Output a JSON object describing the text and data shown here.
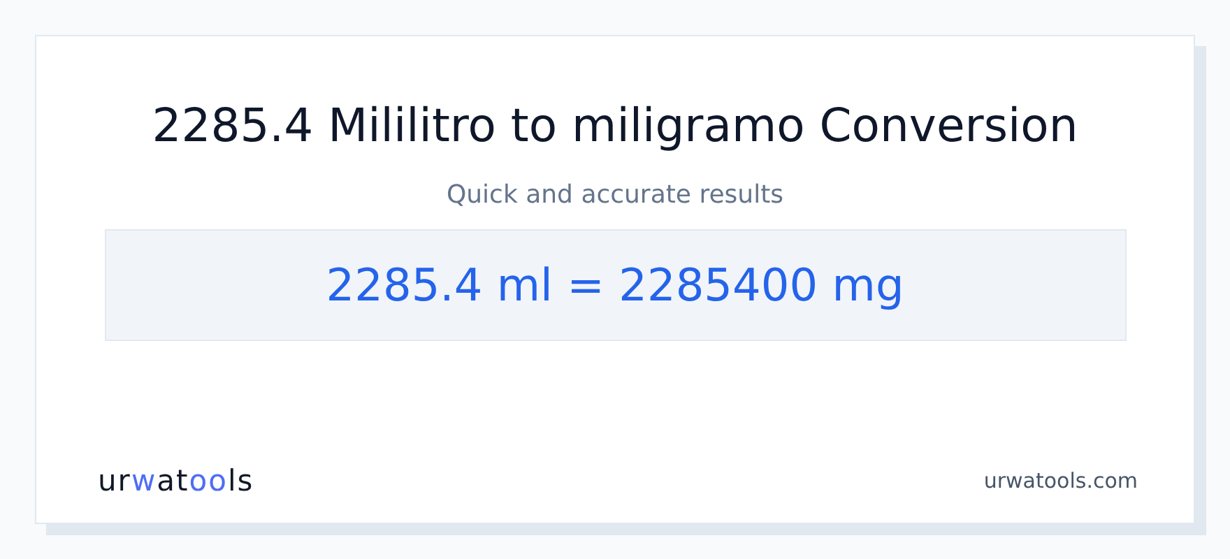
{
  "title": "2285.4 Mililitro to miligramo Conversion",
  "subtitle": "Quick and accurate results",
  "result": "2285.4 ml = 2285400 mg",
  "logo": [
    {
      "text": "ur",
      "accent": false
    },
    {
      "text": "w",
      "accent": true
    },
    {
      "text": "at",
      "accent": false
    },
    {
      "text": "oo",
      "accent": true
    },
    {
      "text": "ls",
      "accent": false
    }
  ],
  "site": "urwatools.com"
}
